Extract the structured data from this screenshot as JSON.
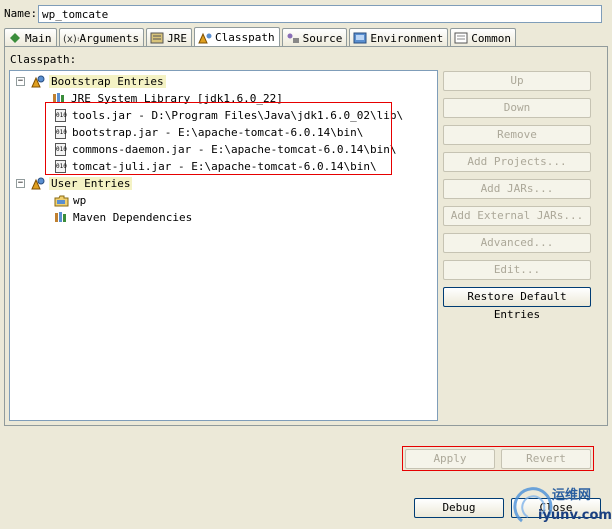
{
  "name": {
    "label": "Name:",
    "value": "wp_tomcate"
  },
  "tabs": [
    {
      "label": "Main",
      "icon": "main-icon"
    },
    {
      "label": "Arguments",
      "icon": "arguments-icon"
    },
    {
      "label": "JRE",
      "icon": "jre-icon"
    },
    {
      "label": "Classpath",
      "icon": "classpath-icon",
      "active": true
    },
    {
      "label": "Source",
      "icon": "source-icon"
    },
    {
      "label": "Environment",
      "icon": "environment-icon"
    },
    {
      "label": "Common",
      "icon": "common-icon"
    }
  ],
  "classpath_label": "Classpath:",
  "tree": {
    "bootstrap": "Bootstrap Entries",
    "jre_library": "JRE System Library [jdk1.6.0_22]",
    "jars": [
      "tools.jar - D:\\Program Files\\Java\\jdk1.6.0_02\\lib\\",
      "bootstrap.jar - E:\\apache-tomcat-6.0.14\\bin\\",
      "commons-daemon.jar - E:\\apache-tomcat-6.0.14\\bin\\",
      "tomcat-juli.jar - E:\\apache-tomcat-6.0.14\\bin\\"
    ],
    "user_entries": "User Entries",
    "wp": "wp",
    "maven": "Maven Dependencies"
  },
  "side_buttons": [
    "Up",
    "Down",
    "Remove",
    "Add Projects...",
    "Add JARs...",
    "Add External JARs...",
    "Advanced...",
    "Edit...",
    "Restore Default Entries"
  ],
  "apply": "Apply",
  "revert": "Revert",
  "debug": "Debug",
  "close": "Close",
  "watermark": {
    "line1": "运维网",
    "line2": "iyunv.com"
  },
  "colors": {
    "highlight_box": "#e60000",
    "accent": "#316ac5"
  }
}
